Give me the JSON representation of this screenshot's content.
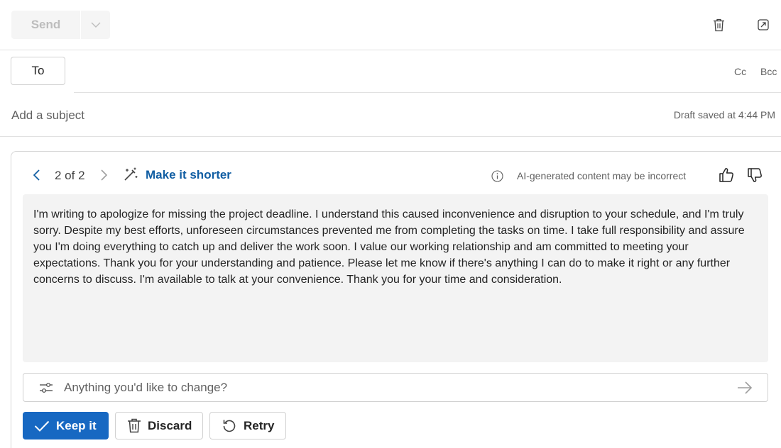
{
  "toolbar": {
    "send_label": "Send",
    "icons": [
      "chevron-down-icon",
      "trash-icon",
      "pop-out-icon"
    ]
  },
  "recipients": {
    "to_label": "To",
    "cc_label": "Cc",
    "bcc_label": "Bcc"
  },
  "subject": {
    "placeholder": "Add a subject",
    "draft_status": "Draft saved at 4:44 PM"
  },
  "ai_card": {
    "counter": "2 of 2",
    "action_label": "Make it shorter",
    "disclaimer": "AI-generated content may be incorrect",
    "body": "I'm writing to apologize for missing the project deadline. I understand this caused inconvenience and disruption to your schedule, and I'm truly sorry. Despite my best efforts, unforeseen circumstances prevented me from completing the tasks on time. I take full responsibility and assure you I'm doing everything to catch up and deliver the work soon. I value our working relationship and am committed to meeting your expectations. Thank you for your understanding and patience. Please let me know if there's anything I can do to make it right or any further concerns to discuss. I'm available to talk at your convenience. Thank you for your time and consideration.",
    "change_placeholder": "Anything you'd like to change?",
    "keep_label": "Keep it",
    "discard_label": "Discard",
    "retry_label": "Retry"
  },
  "colors": {
    "accent": "#1768c2",
    "link": "#115ea3",
    "body_bg": "#f3f3f3"
  }
}
